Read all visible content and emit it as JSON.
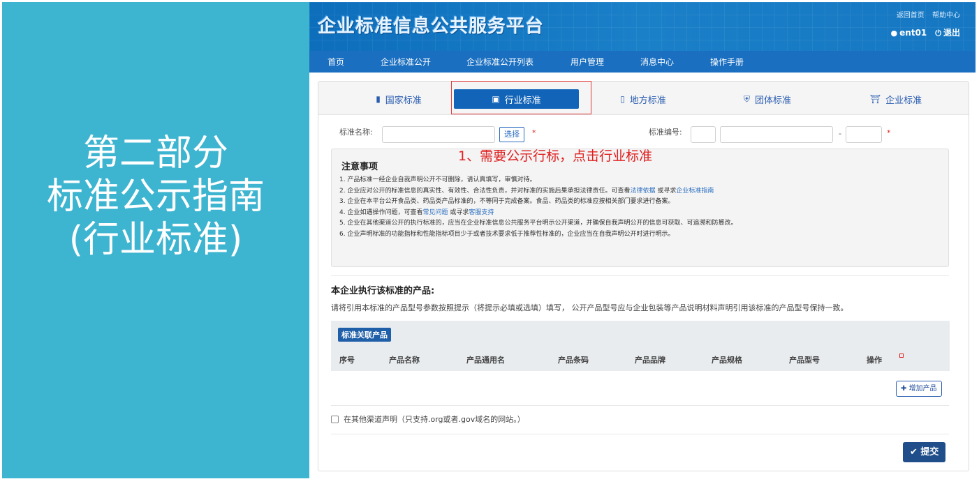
{
  "slide": {
    "title_line1": "第二部分",
    "title_line2": "标准公示指南",
    "title_line3": "(行业标准)",
    "panel_color": "#3db4d0"
  },
  "header": {
    "logo_text": "企业标准信息公共服务平台",
    "links": [
      "返回首页",
      "帮助中心"
    ],
    "user": "ent01",
    "logout": "退出",
    "user_icon": "user-icon",
    "logout_icon": "power-icon"
  },
  "nav": {
    "items": [
      "首页",
      "企业标准公开",
      "企业标准公开列表",
      "用户管理",
      "消息中心",
      "操作手册"
    ]
  },
  "tabs": [
    {
      "label": "国家标准",
      "icon": "book-icon"
    },
    {
      "label": "行业标准",
      "icon": "briefcase-icon"
    },
    {
      "label": "地方标准",
      "icon": "file-icon"
    },
    {
      "label": "团体标准",
      "icon": "shield-icon"
    },
    {
      "label": "企业标准",
      "icon": "bank-icon"
    }
  ],
  "form": {
    "standard_name_label": "标准名称:",
    "select_button": "选择",
    "standard_number_label": "标准编号:",
    "dash": "-",
    "required_mark": "*"
  },
  "annotation": "1、需要公示行标，点击行业标准",
  "notice": {
    "title": "注意事项",
    "items": [
      "1. 产品标准一经企业自我声明公开不可删除，请认真填写，审慎对待。",
      "2. 企业应对公开的标准信息的真实性、有效性、合法性负责，并对标准的实施后果承担法律责任。可查看",
      "3. 企业在本平台公开食品类、药品类产品标准的，不等同于完成备案。食品、药品类的标准应按相关部门要求进行备案。",
      "4. 企业如遇操作问题，可查看",
      "5. 企业在其他渠道公开的执行标准的，应当在企业标准信息公共服务平台明示公开渠道，并确保自我声明公开的信息可获取、可追溯和防篡改。",
      "6. 企业声明标准的功能指标和性能指标项目少于或者技术要求低于推荐性标准的，企业应当在自我声明公开时进行明示。"
    ],
    "link_law": "法律依据",
    "link_mid2": " 或寻求",
    "link_guide": "企业标准指南",
    "link_faq": "常见问题",
    "link_mid4": " 或寻求",
    "link_support": "客服支持"
  },
  "products": {
    "section_title": "本企业执行该标准的产品:",
    "description": "请将引用本标准的产品型号参数按照提示（将提示必填或选填）填写， 公开产品型号应与企业包装等产品说明材料声明引用该标准的产品型号保持一致。",
    "badge": "标准关联产品",
    "columns": [
      "序号",
      "产品名称",
      "产品通用名",
      "产品条码",
      "产品品牌",
      "产品规格",
      "产品型号",
      "操作"
    ],
    "add_button": "增加产品"
  },
  "other_channel": {
    "label": "在其他渠道声明（只支持.org或者.gov域名的网站。）"
  },
  "submit": {
    "label": "提交"
  },
  "colors": {
    "accent": "#1264b8",
    "annotation": "#e02020",
    "submit": "#1f4e8a"
  }
}
